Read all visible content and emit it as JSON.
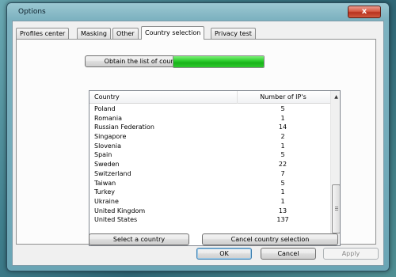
{
  "window": {
    "title": "Options",
    "close_glyph": "x"
  },
  "tabs": [
    {
      "label": "Profiles center"
    },
    {
      "label": "Masking"
    },
    {
      "label": "Other"
    },
    {
      "label": "Country selection"
    },
    {
      "label": "Privacy test"
    }
  ],
  "active_tab": "Country selection",
  "country_panel": {
    "obtain_button": "Obtain the list of countries",
    "progress_fraction": 1.0,
    "progress_color": "#22c022",
    "list": {
      "columns": [
        "Country",
        "Number of IP's"
      ],
      "rows": [
        {
          "country": "Poland",
          "ips": "5"
        },
        {
          "country": "Romania",
          "ips": "1"
        },
        {
          "country": "Russian Federation",
          "ips": "14"
        },
        {
          "country": "Singapore",
          "ips": "2"
        },
        {
          "country": "Slovenia",
          "ips": "1"
        },
        {
          "country": "Spain",
          "ips": "5"
        },
        {
          "country": "Sweden",
          "ips": "22"
        },
        {
          "country": "Switzerland",
          "ips": "7"
        },
        {
          "country": "Taiwan",
          "ips": "5"
        },
        {
          "country": "Turkey",
          "ips": "1"
        },
        {
          "country": "Ukraine",
          "ips": "1"
        },
        {
          "country": "United Kingdom",
          "ips": "13"
        },
        {
          "country": "United States",
          "ips": "137"
        }
      ],
      "scroll_up_icon": "▲",
      "scroll_down_icon": "▼"
    },
    "select_button": "Select a country",
    "cancel_selection_button": "Cancel country selection"
  },
  "dialog_buttons": {
    "ok": "OK",
    "cancel": "Cancel",
    "apply": "Apply"
  }
}
